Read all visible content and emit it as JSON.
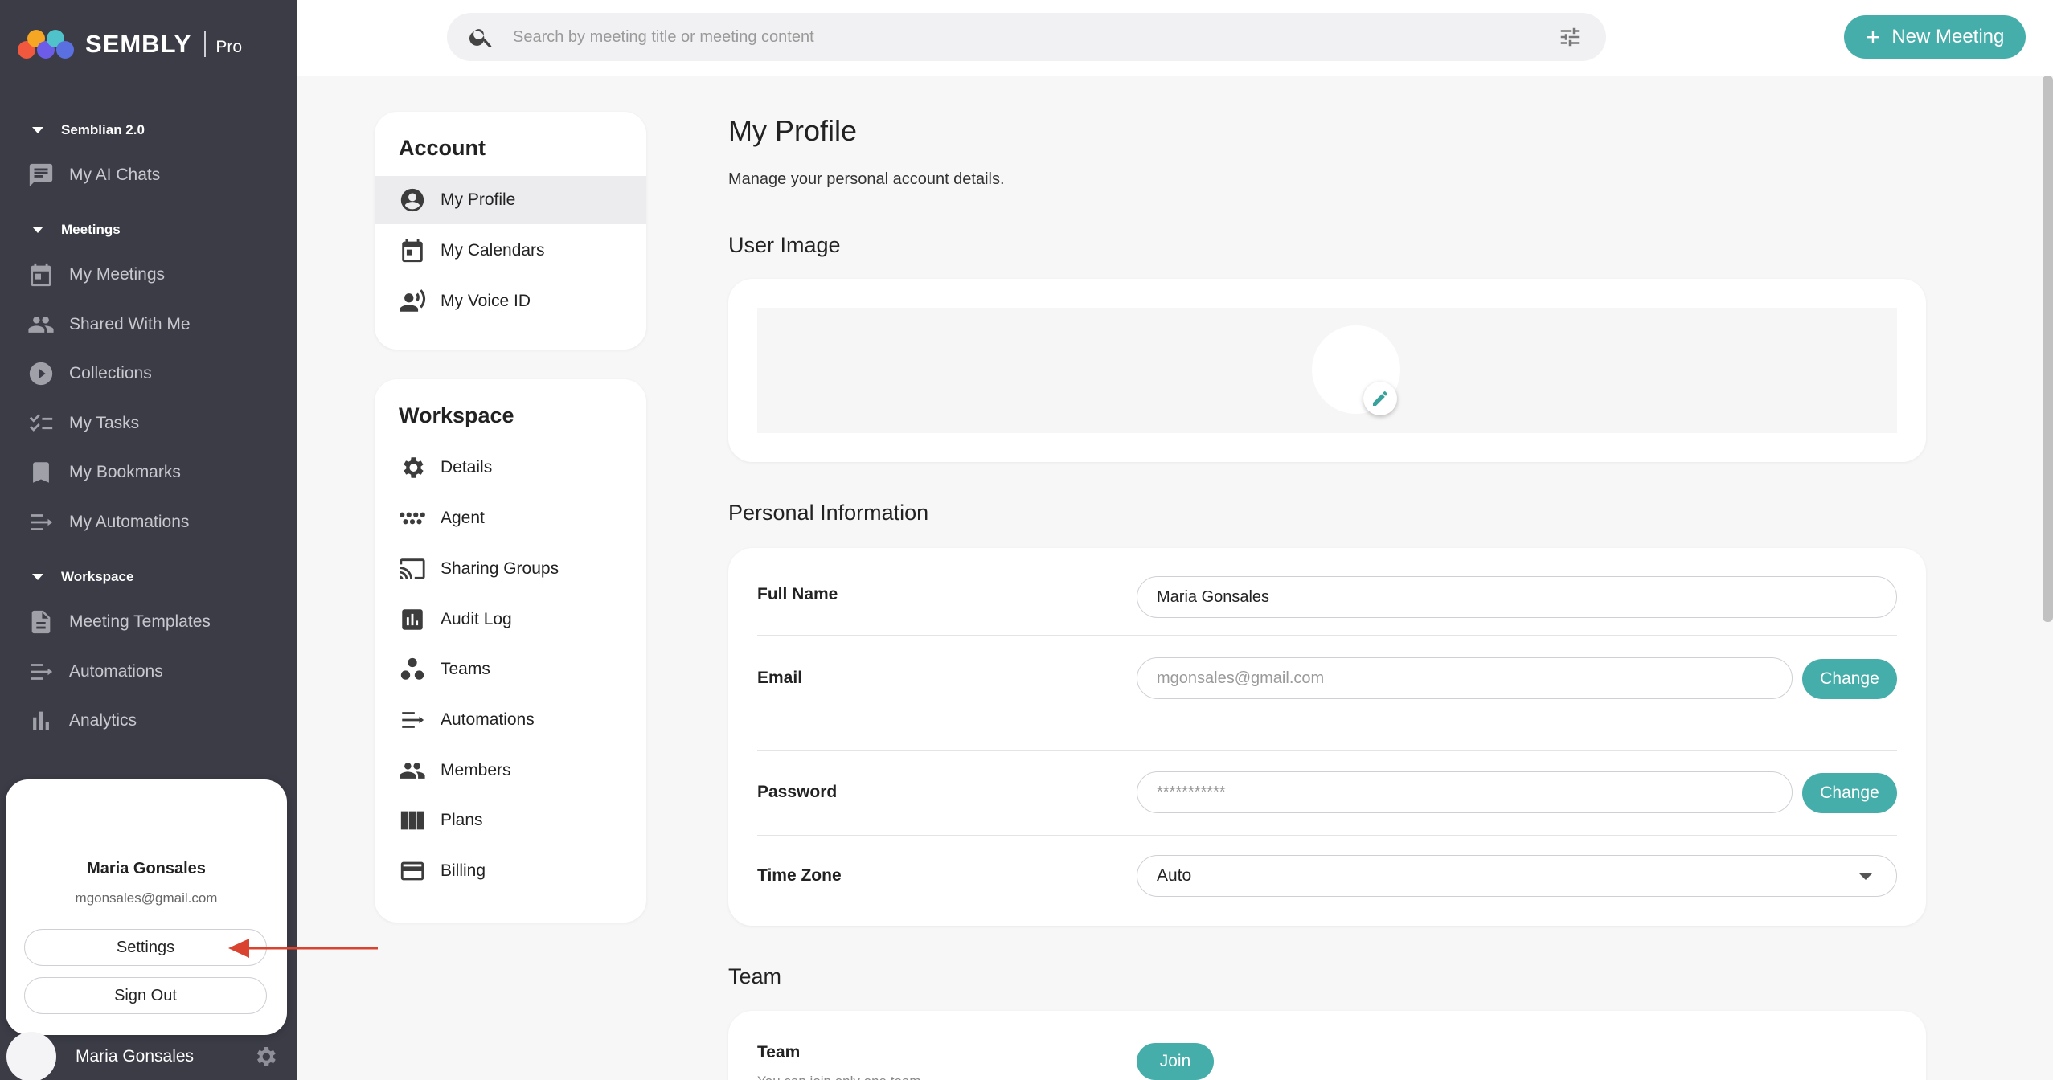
{
  "brand": {
    "name": "SEMBLY",
    "tier": "Pro"
  },
  "sidebar": {
    "sections": [
      {
        "title": "Semblian 2.0",
        "items": [
          {
            "label": "My AI Chats",
            "icon": "chat-icon"
          }
        ]
      },
      {
        "title": "Meetings",
        "items": [
          {
            "label": "My Meetings",
            "icon": "calendar-icon"
          },
          {
            "label": "Shared With Me",
            "icon": "people-icon"
          },
          {
            "label": "Collections",
            "icon": "play-circle-icon"
          },
          {
            "label": "My Tasks",
            "icon": "checklist-icon"
          },
          {
            "label": "My Bookmarks",
            "icon": "bookmark-icon"
          },
          {
            "label": "My Automations",
            "icon": "automation-icon"
          }
        ]
      },
      {
        "title": "Workspace",
        "items": [
          {
            "label": "Meeting Templates",
            "icon": "document-icon"
          },
          {
            "label": "Automations",
            "icon": "automation-icon"
          },
          {
            "label": "Analytics",
            "icon": "bar-chart-icon"
          }
        ]
      }
    ],
    "user_popup": {
      "name": "Maria Gonsales",
      "email": "mgonsales@gmail.com",
      "settings_label": "Settings",
      "signout_label": "Sign Out"
    },
    "user_bar": {
      "name": "Maria Gonsales"
    }
  },
  "topbar": {
    "search_placeholder": "Search by meeting title or meeting content",
    "new_meeting_label": "New Meeting"
  },
  "settings_menu": {
    "account": {
      "title": "Account",
      "items": [
        {
          "label": "My Profile",
          "icon": "account-circle-icon",
          "active": true
        },
        {
          "label": "My Calendars",
          "icon": "calendar-icon"
        },
        {
          "label": "My Voice ID",
          "icon": "voice-id-icon"
        }
      ]
    },
    "workspace": {
      "title": "Workspace",
      "items": [
        {
          "label": "Details",
          "icon": "gear-icon"
        },
        {
          "label": "Agent",
          "icon": "agent-icon"
        },
        {
          "label": "Sharing Groups",
          "icon": "cast-icon"
        },
        {
          "label": "Audit Log",
          "icon": "bar-chart-icon"
        },
        {
          "label": "Teams",
          "icon": "teams-icon"
        },
        {
          "label": "Automations",
          "icon": "automation-icon"
        },
        {
          "label": "Members",
          "icon": "people-icon"
        },
        {
          "label": "Plans",
          "icon": "columns-icon"
        },
        {
          "label": "Billing",
          "icon": "credit-card-icon"
        }
      ]
    }
  },
  "profile": {
    "title": "My Profile",
    "subtitle": "Manage your personal account details.",
    "user_image_title": "User Image",
    "personal_info_title": "Personal Information",
    "fields": {
      "full_name": {
        "label": "Full Name",
        "value": "Maria Gonsales"
      },
      "email": {
        "label": "Email",
        "placeholder": "mgonsales@gmail.com",
        "button": "Change"
      },
      "password": {
        "label": "Password",
        "placeholder": "***********",
        "button": "Change"
      },
      "time_zone": {
        "label": "Time Zone",
        "value": "Auto"
      }
    },
    "team_section_title": "Team",
    "team": {
      "label": "Team",
      "note": "You can join only one team",
      "button": "Join"
    }
  },
  "colors": {
    "accent": "#45aeaa",
    "sidebar_bg": "#3b3c46",
    "annotation_arrow": "#d9432f"
  }
}
